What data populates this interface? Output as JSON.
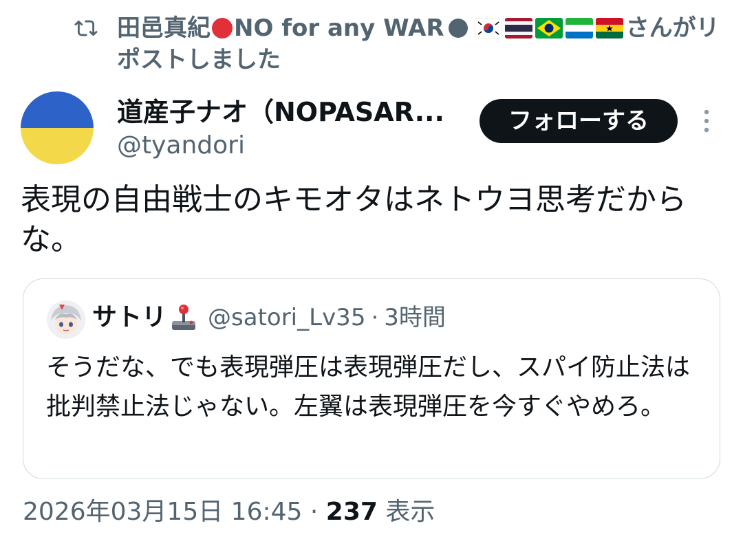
{
  "repost": {
    "icon": "repost-icon",
    "name": "田邑真紀",
    "name_tail": "NO for any WAR",
    "flags": [
      "kr",
      "th",
      "br",
      "sl",
      "gh"
    ],
    "suffix": "さんがリポストしました"
  },
  "author": {
    "display_name": "道産子ナオ（NOPASAR...",
    "handle": "@tyandori",
    "avatar_colors": [
      "#2d62c9",
      "#f3d94a"
    ]
  },
  "follow_button": "フォローする",
  "tweet_text": "表現の自由戦士のキモオタはネトウヨ思考だからな。",
  "quote": {
    "name": "サトリ",
    "handle": "@satori_Lv35",
    "separator": "·",
    "time": "3時間",
    "text": "そうだな、でも表現弾圧は表現弾圧だし、スパイ防止法は批判禁止法じゃない。左翼は表現弾圧を今すぐやめろ。"
  },
  "meta": {
    "timestamp": "2026年03月15日 16:45",
    "separator": "·",
    "views_count": "237",
    "views_label": "表示"
  },
  "colors": {
    "text_primary": "#0f1419",
    "text_secondary": "#536471",
    "border": "#cfd9de"
  }
}
